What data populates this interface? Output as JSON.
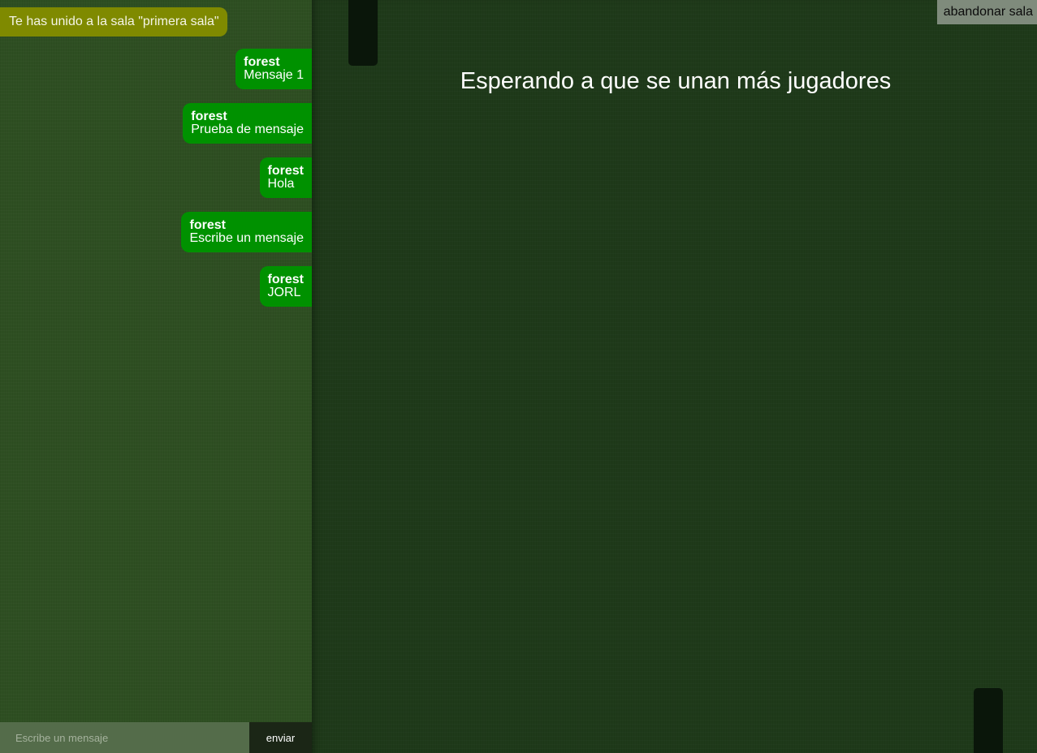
{
  "chat": {
    "system_message": "Te has unido a la sala \"primera sala\"",
    "messages": [
      {
        "author": "forest",
        "text": "Mensaje 1"
      },
      {
        "author": "forest",
        "text": "Prueba de mensaje"
      },
      {
        "author": "forest",
        "text": "Hola"
      },
      {
        "author": "forest",
        "text": "Escribe un mensaje"
      },
      {
        "author": "forest",
        "text": "JORL"
      }
    ],
    "input": {
      "value": "",
      "placeholder": "Escribe un mensaje"
    },
    "send_label": "enviar"
  },
  "game": {
    "status": "Esperando a que se unan más jugadores",
    "leave_label": "abandonar sala"
  },
  "colors": {
    "system_message_bg": "#7f8a00",
    "message_bg": "#009100",
    "chat_bg": "#2e4f22",
    "game_bg": "#1f3a1a",
    "paddle": "#0a160a"
  }
}
